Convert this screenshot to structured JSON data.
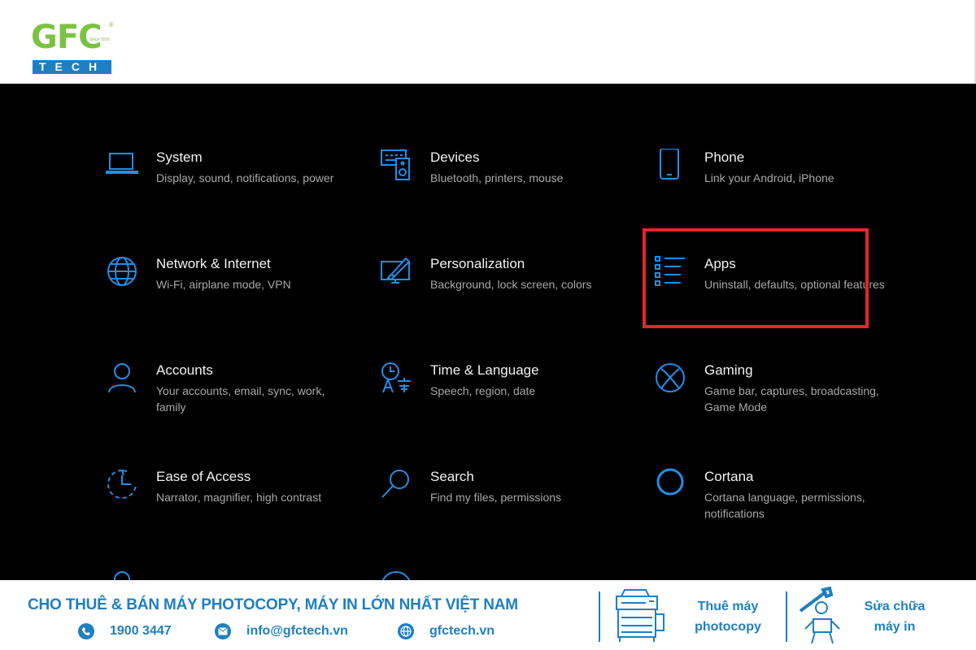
{
  "brand": {
    "logo_main": "GFC",
    "logo_sub": "TECH",
    "logo_since": "Since 2016",
    "logo_registered": "®"
  },
  "settings": {
    "tiles": [
      {
        "title": "System",
        "desc": "Display, sound, notifications, power",
        "icon": "laptop-icon"
      },
      {
        "title": "Devices",
        "desc": "Bluetooth, printers, mouse",
        "icon": "keyboard-speaker-icon"
      },
      {
        "title": "Phone",
        "desc": "Link your Android, iPhone",
        "icon": "phone-icon"
      },
      {
        "title": "Network & Internet",
        "desc": "Wi-Fi, airplane mode, VPN",
        "icon": "globe-icon"
      },
      {
        "title": "Personalization",
        "desc": "Background, lock screen, colors",
        "icon": "brush-monitor-icon"
      },
      {
        "title": "Apps",
        "desc": "Uninstall, defaults, optional features",
        "icon": "list-icon",
        "highlighted": true
      },
      {
        "title": "Accounts",
        "desc": "Your accounts, email, sync, work, family",
        "icon": "person-icon"
      },
      {
        "title": "Time & Language",
        "desc": "Speech, region, date",
        "icon": "clock-language-icon"
      },
      {
        "title": "Gaming",
        "desc": "Game bar, captures, broadcasting, Game Mode",
        "icon": "xbox-icon"
      },
      {
        "title": "Ease of Access",
        "desc": "Narrator, magnifier, high contrast",
        "icon": "ease-of-access-icon"
      },
      {
        "title": "Search",
        "desc": "Find my files, permissions",
        "icon": "magnifier-icon"
      },
      {
        "title": "Cortana",
        "desc": "Cortana language, permissions, notifications",
        "icon": "cortana-ring-icon"
      }
    ],
    "accent_color": "#1f8fe8",
    "highlight_color": "#e4262a"
  },
  "footer": {
    "headline": "CHO THUÊ & BÁN MÁY PHOTOCOPY, MÁY IN LỚN NHẤT VIỆT NAM",
    "phone": "1900 3447",
    "email": "info@gfctech.vn",
    "website": "gfctech.vn",
    "service1_line1": "Thuê máy",
    "service1_line2": "photocopy",
    "service2_line1": "Sửa chữa",
    "service2_line2": "máy in",
    "brand_color": "#1e7fc2"
  }
}
